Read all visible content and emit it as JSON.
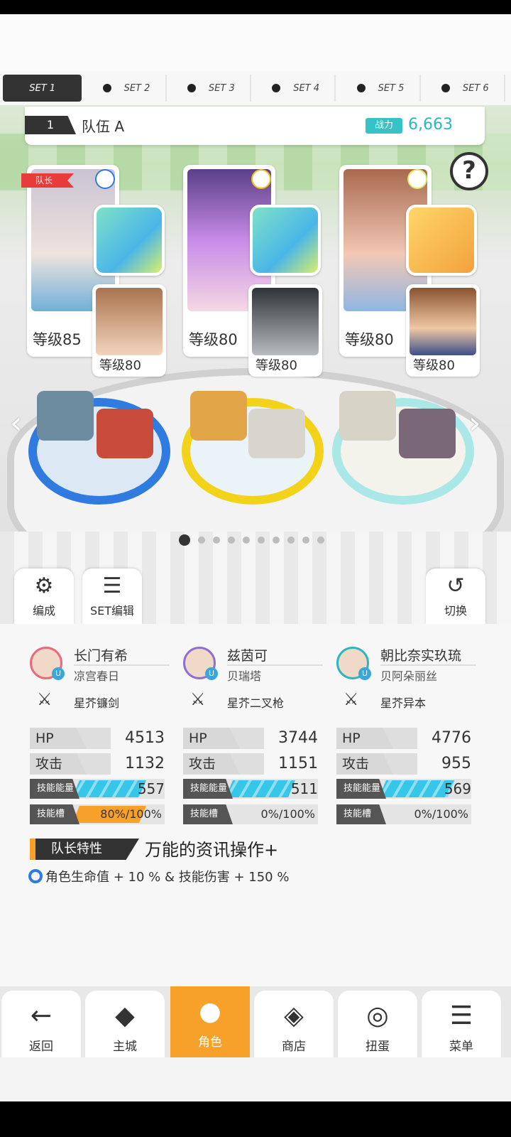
{
  "set_tabs": [
    "SET 1",
    "SET 2",
    "SET 3",
    "SET 4",
    "SET 5",
    "SET 6"
  ],
  "team": {
    "number": "1",
    "name": "队伍 A",
    "power_label": "战力",
    "power": "6,663"
  },
  "leader_tag": "队长",
  "help_icon": "?",
  "cards": [
    {
      "level": "等级85",
      "support_level": "等级80"
    },
    {
      "level": "等级80",
      "support_level": "等级80"
    },
    {
      "level": "等级80",
      "support_level": "等级80"
    }
  ],
  "pager": {
    "total": 10,
    "current": 1
  },
  "tools": {
    "formation": "编成",
    "set_edit": "SET编辑",
    "switch": "切换"
  },
  "members": [
    {
      "name": "长门有希",
      "seiyuu": "凉宫春日",
      "weapon": "星芥镰剑",
      "hp": "4513",
      "atk": "1132",
      "skill_energy": "557",
      "skill_slot": "80%/100%"
    },
    {
      "name": "兹茵可",
      "seiyuu": "贝瑞塔",
      "weapon": "星芥二叉枪",
      "hp": "3744",
      "atk": "1151",
      "skill_energy": "511",
      "skill_slot": "0%/100%"
    },
    {
      "name": "朝比奈实玖琉",
      "seiyuu": "贝阿朵丽丝",
      "weapon": "星芥异本",
      "hp": "4776",
      "atk": "955",
      "skill_energy": "569",
      "skill_slot": "0%/100%"
    }
  ],
  "stat_labels": {
    "hp": "HP",
    "atk": "攻击",
    "energy": "技能能量",
    "slot": "技能槽"
  },
  "skill_slot_fill": [
    0.8,
    0,
    0
  ],
  "skill_energy_fill": [
    0.8,
    0.75,
    0.82
  ],
  "leader_skill": {
    "label": "队长特性",
    "title": "万能的资讯操作+",
    "desc": "角色生命值 + 10 % & 技能伤害 + 150 %"
  },
  "nav": {
    "back": "返回",
    "city": "主城",
    "character": "角色",
    "shop": "商店",
    "gacha": "扭蛋",
    "menu": "菜单"
  },
  "colors": {
    "accent": "#f7a12a",
    "power": "#36c3c6",
    "leader": "#e83b3b"
  }
}
